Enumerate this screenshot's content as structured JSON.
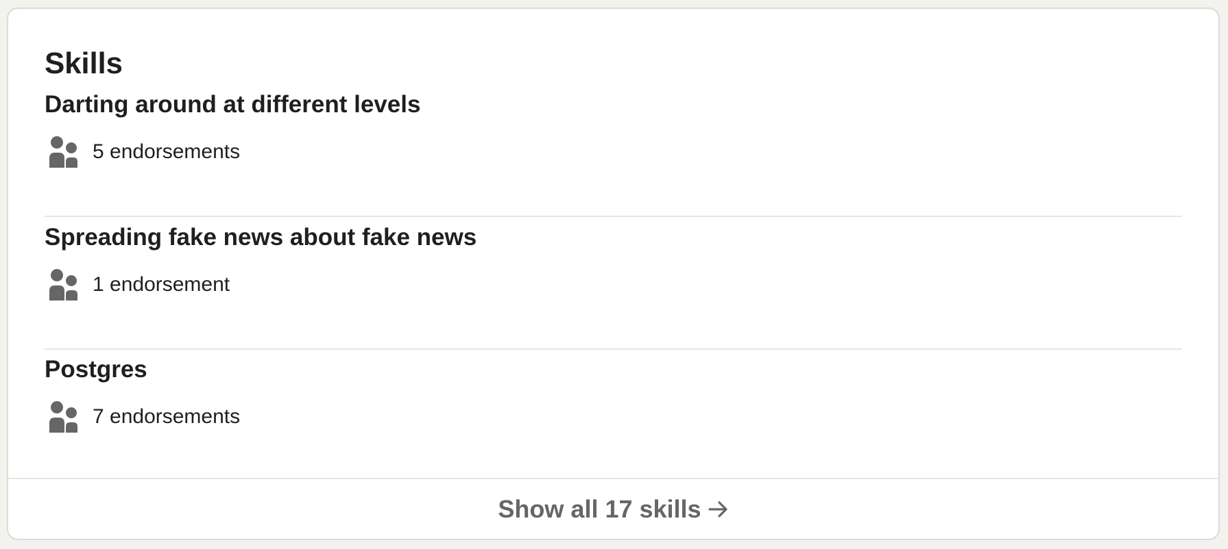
{
  "section": {
    "title": "Skills"
  },
  "skills": [
    {
      "name": "Darting around at different levels",
      "endorsements": "5 endorsements",
      "icon": "people-icon"
    },
    {
      "name": "Spreading fake news about fake news",
      "endorsements": "1 endorsement",
      "icon": "people-icon"
    },
    {
      "name": "Postgres",
      "endorsements": "7 endorsements",
      "icon": "people-icon"
    }
  ],
  "footer": {
    "label": "Show all 17 skills",
    "icon": "arrow-right-icon"
  },
  "colors": {
    "page_background": "#f4f2ee",
    "card_background": "#ffffff",
    "text_primary": "#1f1f1f",
    "text_secondary": "#666666",
    "icon": "#666666",
    "divider": "#e8e6e2"
  }
}
